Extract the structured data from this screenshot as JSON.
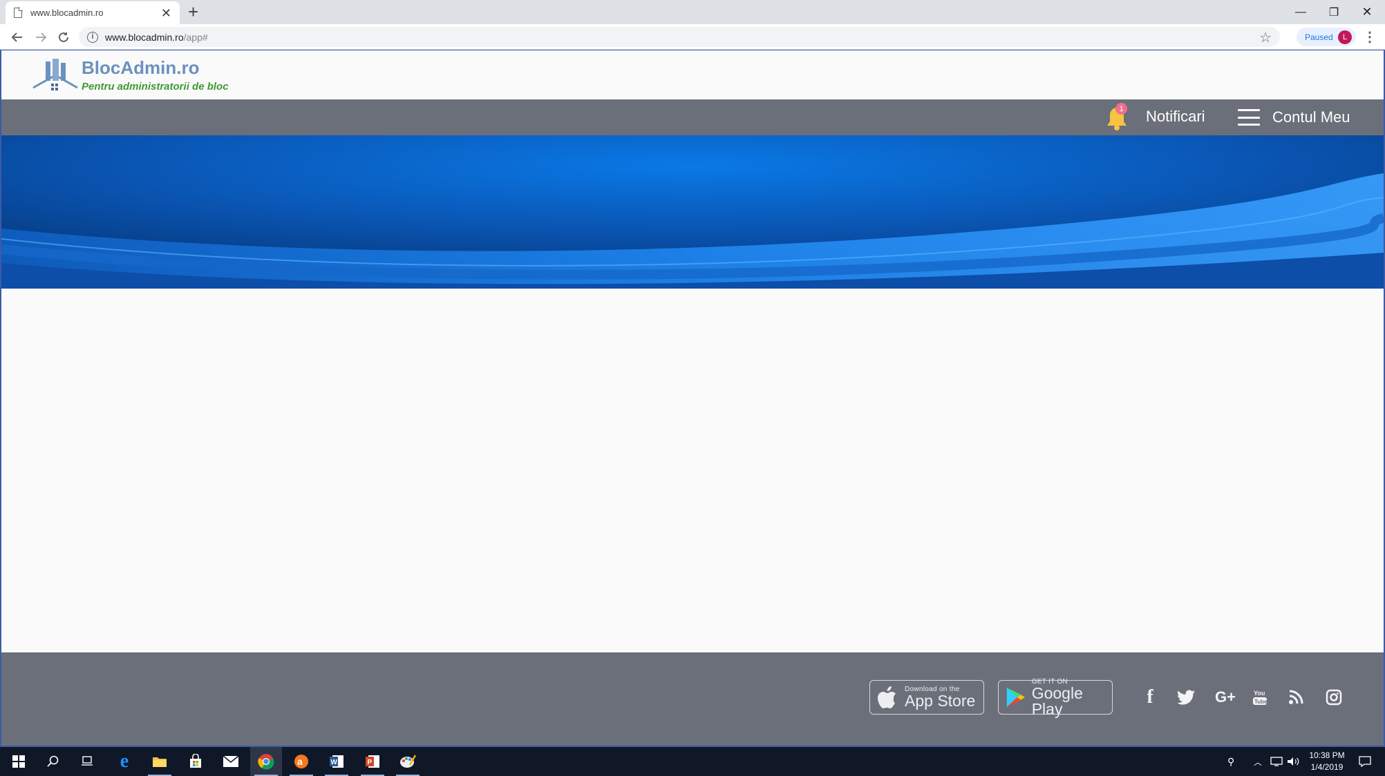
{
  "browser": {
    "tab_title": "www.blocadmin.ro",
    "url_host": "www.blocadmin.ro",
    "url_path": "/app#",
    "profile_status": "Paused",
    "profile_initial": "L"
  },
  "site": {
    "brand": "BlocAdmin.ro",
    "tagline": "Pentru administratorii de bloc",
    "colors": {
      "brand": "#6a91bf",
      "tagline": "#3f9a34",
      "navbar": "#6b6f7a",
      "banner": "#0a6fd8"
    }
  },
  "nav": {
    "notifications_badge": "1",
    "notifications_label": "Notificari",
    "account_label": "Contul Meu"
  },
  "footer": {
    "app_store": {
      "small": "Download on the",
      "big": "App Store"
    },
    "google_play": {
      "small": "GET IT ON",
      "big": "Google Play"
    },
    "social_icons": [
      "facebook-icon",
      "twitter-icon",
      "google-plus-icon",
      "youtube-icon",
      "rss-icon",
      "instagram-icon"
    ]
  },
  "taskbar": {
    "apps": [
      "start-icon",
      "search-icon",
      "task-view-icon",
      "edge-icon",
      "file-explorer-icon",
      "store-icon",
      "mail-icon",
      "chrome-icon",
      "avast-icon",
      "word-icon",
      "powerpoint-icon",
      "paint-icon"
    ],
    "time": "10:38 PM",
    "date": "1/4/2019"
  }
}
